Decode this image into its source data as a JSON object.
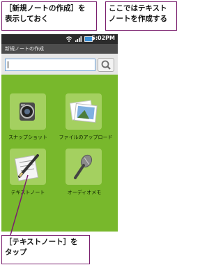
{
  "callouts": {
    "top_left": [
      "［新規ノートの作成］を",
      "表示しておく"
    ],
    "top_right": [
      "ここではテキスト",
      "ノートを作成する"
    ],
    "bottom": [
      "［テキストノート］を",
      "タップ"
    ]
  },
  "status_bar": {
    "time": "5:02PM",
    "icons": [
      "wifi-icon",
      "signal-icon",
      "battery-icon"
    ]
  },
  "app": {
    "title": "新規ノートの作成",
    "search_placeholder": "",
    "items": [
      {
        "label": "スナップショット",
        "icon": "camera-icon"
      },
      {
        "label": "ファイルのアップロード",
        "icon": "photo-upload-icon"
      },
      {
        "label": "テキストノート",
        "icon": "pen-note-icon"
      },
      {
        "label": "オーディオメモ",
        "icon": "microphone-icon"
      }
    ]
  },
  "colors": {
    "background_green": "#78b82c",
    "tile_green": "#a4d060",
    "callout_border": "#7a1f6e"
  }
}
